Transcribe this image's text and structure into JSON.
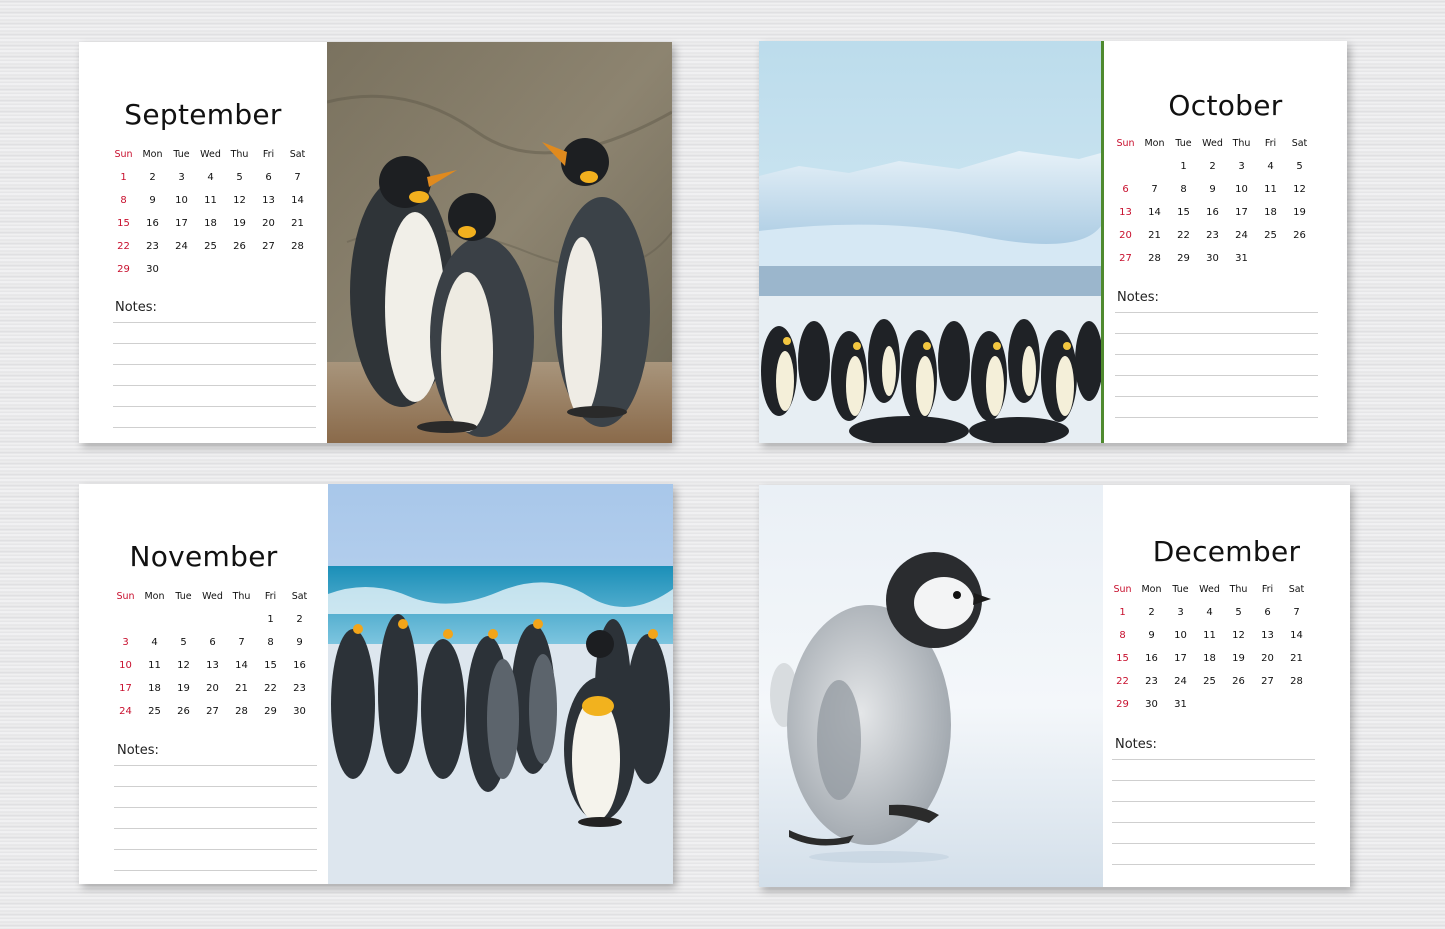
{
  "weekdays": [
    "Sun",
    "Mon",
    "Tue",
    "Wed",
    "Thu",
    "Fri",
    "Sat"
  ],
  "notes_label": "Notes:",
  "colors": {
    "sunday": "#c8102e",
    "text": "#111111",
    "line": "#cfcfcf"
  },
  "months": [
    {
      "name": "September",
      "photo": "king-penguins-rock-photo",
      "weeks": [
        [
          "1",
          "2",
          "3",
          "4",
          "5",
          "6",
          "7"
        ],
        [
          "8",
          "9",
          "10",
          "11",
          "12",
          "13",
          "14"
        ],
        [
          "15",
          "16",
          "17",
          "18",
          "19",
          "20",
          "21"
        ],
        [
          "22",
          "23",
          "24",
          "25",
          "26",
          "27",
          "28"
        ],
        [
          "29",
          "30",
          "",
          "",
          "",
          "",
          ""
        ]
      ]
    },
    {
      "name": "October",
      "photo": "emperor-penguin-colony-photo",
      "weeks": [
        [
          "",
          "",
          "1",
          "2",
          "3",
          "4",
          "5"
        ],
        [
          "6",
          "7",
          "8",
          "9",
          "10",
          "11",
          "12"
        ],
        [
          "13",
          "14",
          "15",
          "16",
          "17",
          "18",
          "19"
        ],
        [
          "20",
          "21",
          "22",
          "23",
          "24",
          "25",
          "26"
        ],
        [
          "27",
          "28",
          "29",
          "30",
          "31",
          "",
          ""
        ]
      ]
    },
    {
      "name": "November",
      "photo": "king-penguins-beach-photo",
      "weeks": [
        [
          "",
          "",
          "",
          "",
          "",
          "1",
          "2"
        ],
        [
          "3",
          "4",
          "5",
          "6",
          "7",
          "8",
          "9"
        ],
        [
          "10",
          "11",
          "12",
          "13",
          "14",
          "15",
          "16"
        ],
        [
          "17",
          "18",
          "19",
          "20",
          "21",
          "22",
          "23"
        ],
        [
          "24",
          "25",
          "26",
          "27",
          "28",
          "29",
          "30"
        ]
      ]
    },
    {
      "name": "December",
      "photo": "penguin-chick-photo",
      "weeks": [
        [
          "1",
          "2",
          "3",
          "4",
          "5",
          "6",
          "7"
        ],
        [
          "8",
          "9",
          "10",
          "11",
          "12",
          "13",
          "14"
        ],
        [
          "15",
          "16",
          "17",
          "18",
          "19",
          "20",
          "21"
        ],
        [
          "22",
          "23",
          "24",
          "25",
          "26",
          "27",
          "28"
        ],
        [
          "29",
          "30",
          "31",
          "",
          "",
          "",
          ""
        ]
      ]
    }
  ]
}
